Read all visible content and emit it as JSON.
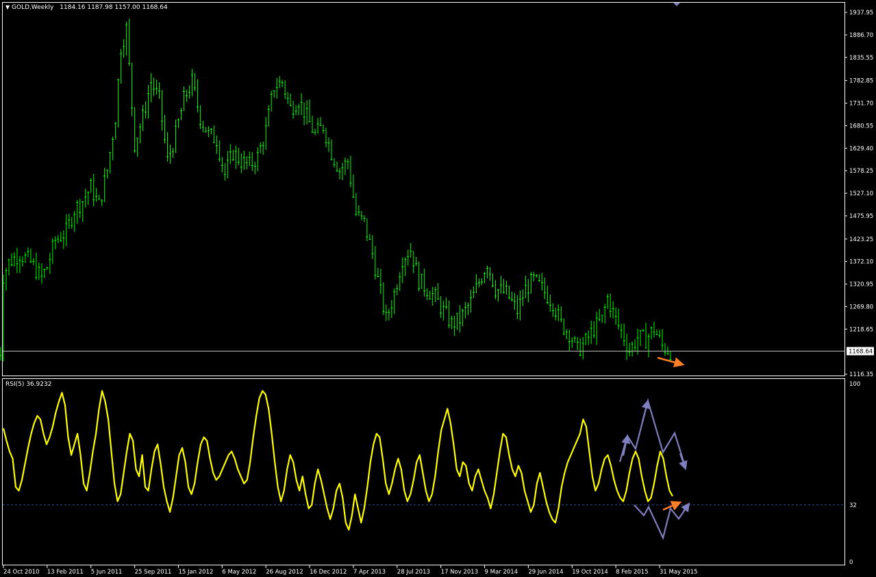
{
  "header": {
    "symbol": "GOLD,Weekly",
    "ohlc": "1184.16 1187.98 1157.00 1168.64"
  },
  "rsi_header": "RSI(5) 36.9232",
  "current_price_label": "1168.64",
  "colors": {
    "background": "#000000",
    "candles": "#00ff00",
    "rsi_line": "#ffff00",
    "level_line": "#2f4f7f",
    "price_line": "#c0c0c0",
    "arrow_orange": "#ff7f27",
    "arrow_purple": "#7f7fbf",
    "axis": "#ffffff"
  },
  "chart_data": [
    {
      "type": "candlestick",
      "title": "GOLD,Weekly",
      "price_ticks": [
        "1937.95",
        "1886.70",
        "1835.55",
        "1782.85",
        "1731.70",
        "1680.55",
        "1629.40",
        "1578.25",
        "1527.10",
        "1475.95",
        "1423.25",
        "1372.10",
        "1320.95",
        "1269.80",
        "1218.65",
        "1116.35"
      ],
      "ylim": [
        1116.35,
        1937.95
      ],
      "current_price": 1168.64,
      "time_ticks": [
        "24 Oct 2010",
        "13 Feb 2011",
        "5 Jun 2011",
        "25 Sep 2011",
        "15 Jan 2012",
        "6 May 2012",
        "26 Aug 2012",
        "16 Dec 2012",
        "7 Apr 2013",
        "28 Jul 2013",
        "17 Nov 2013",
        "9 Mar 2014",
        "29 Jun 2014",
        "19 Oct 2014",
        "8 Feb 2015",
        "31 May 2015"
      ],
      "close_path": [
        [
          "2010-10-24",
          1340
        ],
        [
          "2010-11-07",
          1370
        ],
        [
          "2010-12-05",
          1390
        ],
        [
          "2011-01-02",
          1370
        ],
        [
          "2011-01-30",
          1335
        ],
        [
          "2011-02-13",
          1360
        ],
        [
          "2011-03-06",
          1420
        ],
        [
          "2011-04-03",
          1440
        ],
        [
          "2011-04-24",
          1490
        ],
        [
          "2011-05-15",
          1510
        ],
        [
          "2011-06-05",
          1540
        ],
        [
          "2011-06-26",
          1500
        ],
        [
          "2011-07-17",
          1580
        ],
        [
          "2011-08-07",
          1700
        ],
        [
          "2011-08-21",
          1860
        ],
        [
          "2011-09-04",
          1900
        ],
        [
          "2011-09-25",
          1640
        ],
        [
          "2011-10-16",
          1700
        ],
        [
          "2011-11-06",
          1780
        ],
        [
          "2011-11-27",
          1740
        ],
        [
          "2011-12-18",
          1600
        ],
        [
          "2012-01-08",
          1660
        ],
        [
          "2012-01-29",
          1740
        ],
        [
          "2012-02-19",
          1780
        ],
        [
          "2012-03-11",
          1700
        ],
        [
          "2012-04-01",
          1660
        ],
        [
          "2012-04-22",
          1650
        ],
        [
          "2012-05-13",
          1570
        ],
        [
          "2012-06-03",
          1620
        ],
        [
          "2012-06-24",
          1600
        ],
        [
          "2012-07-15",
          1590
        ],
        [
          "2012-08-05",
          1610
        ],
        [
          "2012-08-26",
          1670
        ],
        [
          "2012-09-16",
          1770
        ],
        [
          "2012-10-07",
          1780
        ],
        [
          "2012-10-28",
          1720
        ],
        [
          "2012-11-18",
          1740
        ],
        [
          "2012-12-09",
          1700
        ],
        [
          "2012-12-30",
          1660
        ],
        [
          "2013-01-20",
          1680
        ],
        [
          "2013-02-10",
          1620
        ],
        [
          "2013-03-03",
          1580
        ],
        [
          "2013-03-24",
          1600
        ],
        [
          "2013-04-14",
          1480
        ],
        [
          "2013-05-05",
          1460
        ],
        [
          "2013-05-26",
          1390
        ],
        [
          "2013-06-16",
          1300
        ],
        [
          "2013-06-30",
          1240
        ],
        [
          "2013-07-21",
          1300
        ],
        [
          "2013-08-11",
          1380
        ],
        [
          "2013-09-01",
          1400
        ],
        [
          "2013-09-22",
          1330
        ],
        [
          "2013-10-13",
          1310
        ],
        [
          "2013-11-03",
          1290
        ],
        [
          "2013-11-24",
          1260
        ],
        [
          "2013-12-15",
          1230
        ],
        [
          "2014-01-05",
          1240
        ],
        [
          "2014-02-02",
          1280
        ],
        [
          "2014-03-02",
          1340
        ],
        [
          "2014-03-16",
          1370
        ],
        [
          "2014-04-06",
          1310
        ],
        [
          "2014-05-04",
          1300
        ],
        [
          "2014-06-01",
          1260
        ],
        [
          "2014-06-22",
          1310
        ],
        [
          "2014-07-13",
          1330
        ],
        [
          "2014-08-03",
          1310
        ],
        [
          "2014-08-31",
          1280
        ],
        [
          "2014-09-21",
          1230
        ],
        [
          "2014-10-12",
          1210
        ],
        [
          "2014-11-02",
          1170
        ],
        [
          "2014-11-23",
          1190
        ],
        [
          "2014-12-14",
          1220
        ],
        [
          "2015-01-04",
          1240
        ],
        [
          "2015-01-18",
          1290
        ],
        [
          "2015-02-08",
          1240
        ],
        [
          "2015-03-01",
          1200
        ],
        [
          "2015-03-15",
          1170
        ],
        [
          "2015-04-05",
          1200
        ],
        [
          "2015-04-26",
          1195
        ],
        [
          "2015-05-17",
          1220
        ],
        [
          "2015-06-07",
          1180
        ],
        [
          "2015-06-28",
          1168.64
        ]
      ]
    },
    {
      "type": "line",
      "title": "RSI(5) 36.9232",
      "ylim": [
        0,
        100
      ],
      "level_ticks": [
        "100",
        "32",
        "0"
      ],
      "level": 32,
      "last_value": 36.9232,
      "values": [
        75,
        68,
        62,
        58,
        42,
        40,
        46,
        55,
        64,
        72,
        78,
        82,
        80,
        72,
        66,
        70,
        76,
        84,
        90,
        95,
        88,
        70,
        60,
        66,
        72,
        60,
        44,
        40,
        50,
        62,
        72,
        86,
        96,
        90,
        80,
        62,
        44,
        34,
        38,
        50,
        62,
        72,
        68,
        52,
        48,
        60,
        42,
        40,
        52,
        62,
        66,
        55,
        42,
        34,
        28,
        36,
        48,
        60,
        64,
        56,
        42,
        38,
        44,
        56,
        66,
        70,
        68,
        58,
        50,
        46,
        48,
        52,
        56,
        60,
        62,
        58,
        52,
        48,
        44,
        46,
        56,
        70,
        82,
        92,
        96,
        94,
        86,
        72,
        56,
        42,
        34,
        40,
        52,
        60,
        56,
        46,
        40,
        48,
        38,
        30,
        32,
        44,
        52,
        46,
        38,
        30,
        24,
        30,
        40,
        44,
        36,
        22,
        18,
        26,
        38,
        30,
        22,
        30,
        42,
        56,
        66,
        72,
        70,
        58,
        44,
        38,
        44,
        52,
        58,
        52,
        40,
        34,
        38,
        46,
        56,
        60,
        50,
        40,
        34,
        38,
        48,
        62,
        74,
        80,
        86,
        78,
        66,
        52,
        48,
        56,
        54,
        44,
        40,
        48,
        52,
        46,
        40,
        36,
        30,
        38,
        50,
        62,
        72,
        70,
        60,
        52,
        48,
        54,
        50,
        40,
        34,
        28,
        32,
        44,
        50,
        42,
        34,
        28,
        24,
        22,
        30,
        42,
        50,
        56,
        60,
        64,
        68,
        72,
        80,
        76,
        62,
        48,
        40,
        44,
        52,
        58,
        60,
        54,
        46,
        40,
        36,
        34,
        40,
        50,
        58,
        62,
        58,
        48,
        40,
        34,
        36,
        44,
        54,
        62,
        58,
        48,
        40,
        36.92
      ],
      "annotations": "projection arrows"
    }
  ]
}
